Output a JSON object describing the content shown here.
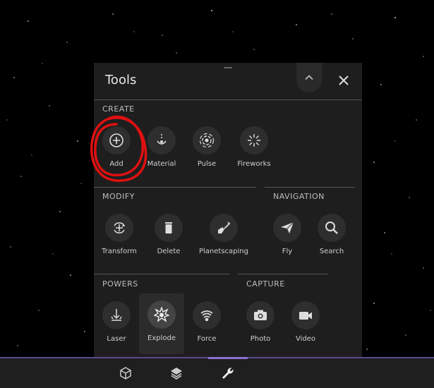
{
  "panel": {
    "title": "Tools",
    "collapse_icon": "chevron-up-icon",
    "close_icon": "close-icon"
  },
  "sections": {
    "create": {
      "label": "CREATE",
      "tools": [
        {
          "label": "Add",
          "icon": "plus-circle-icon"
        },
        {
          "label": "Material",
          "icon": "material-drop-icon"
        },
        {
          "label": "Pulse",
          "icon": "pulse-icon"
        },
        {
          "label": "Fireworks",
          "icon": "fireworks-icon"
        }
      ]
    },
    "modify": {
      "label": "MODIFY",
      "tools": [
        {
          "label": "Transform",
          "icon": "transform-icon"
        },
        {
          "label": "Delete",
          "icon": "trash-icon"
        },
        {
          "label": "Planetscaping",
          "icon": "shovel-icon"
        }
      ]
    },
    "navigation": {
      "label": "NAVIGATION",
      "tools": [
        {
          "label": "Fly",
          "icon": "paper-plane-icon"
        },
        {
          "label": "Search",
          "icon": "search-icon"
        }
      ]
    },
    "powers": {
      "label": "POWERS",
      "tools": [
        {
          "label": "Laser",
          "icon": "laser-icon"
        },
        {
          "label": "Explode",
          "icon": "explode-icon",
          "selected": true
        },
        {
          "label": "Force",
          "icon": "force-icon"
        }
      ]
    },
    "capture": {
      "label": "CAPTURE",
      "tools": [
        {
          "label": "Photo",
          "icon": "camera-icon"
        },
        {
          "label": "Video",
          "icon": "video-camera-icon"
        }
      ]
    }
  },
  "bottom_nav": {
    "items": [
      {
        "icon": "cube-icon"
      },
      {
        "icon": "layers-icon"
      },
      {
        "icon": "wrench-icon",
        "active": true
      }
    ]
  },
  "colors": {
    "accent": "#8a72d1",
    "annotation": "#e01010",
    "panel_bg": "#1e1e1e"
  }
}
